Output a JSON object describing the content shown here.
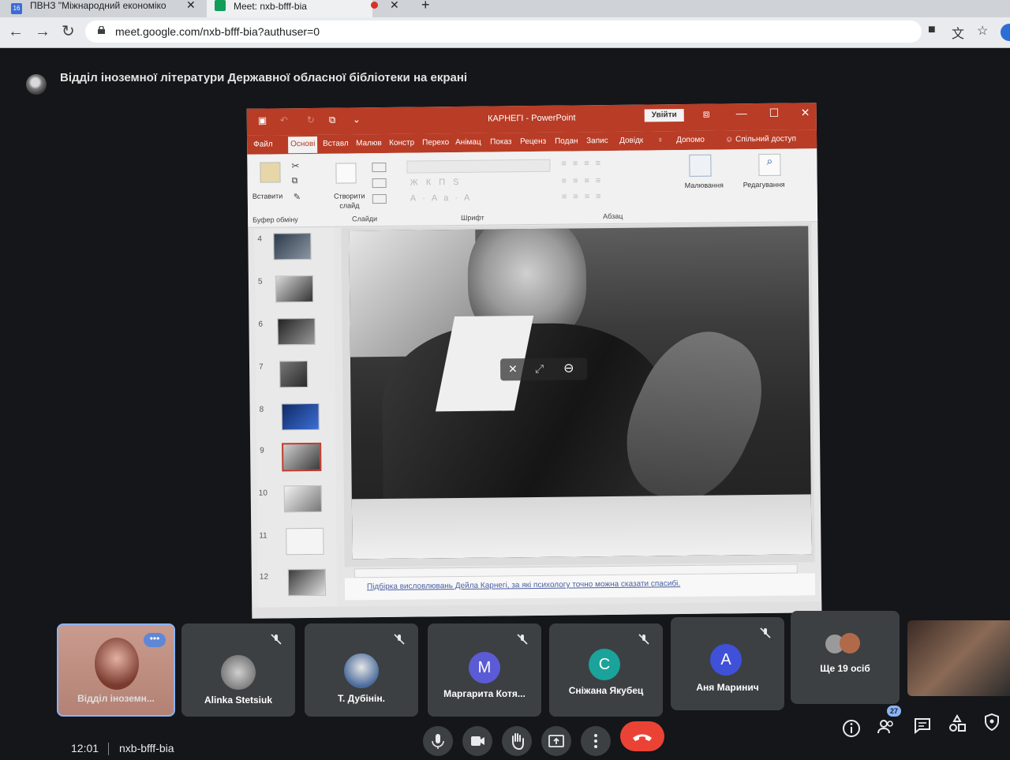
{
  "browser": {
    "tabs": [
      {
        "title": "ПВНЗ \"Міжнародний економіко",
        "favicon_text": "16"
      },
      {
        "title": "Meet: nxb-bfff-bia"
      }
    ],
    "url": "meet.google.com/nxb-bfff-bia?authuser=0"
  },
  "meet": {
    "presenter_text": "Відділ іноземної літератури Державної обласної бібліотеки на екрані",
    "participants": [
      {
        "name": "Відділ іноземн...",
        "kind": "video"
      },
      {
        "name": "Alinka Stetsiuk",
        "kind": "photo",
        "muted": true
      },
      {
        "name": "Т. Дубінін.",
        "kind": "photo",
        "muted": true
      },
      {
        "name": "Маргарита Котя...",
        "kind": "letter",
        "letter": "М",
        "color": "#5b5bd6",
        "muted": true
      },
      {
        "name": "Сніжана Якубец",
        "kind": "letter",
        "letter": "С",
        "color": "#1aa39a",
        "muted": true
      },
      {
        "name": "Аня Маринич",
        "kind": "letter",
        "letter": "А",
        "color": "#3f51d9",
        "muted": true
      },
      {
        "name": "Ще 19 осіб",
        "kind": "more"
      }
    ],
    "clock": "12:01",
    "meeting_code": "nxb-bfff-bia",
    "participant_count": "27",
    "controls": [
      "mic-icon",
      "camera-icon",
      "raise-hand-icon",
      "present-screen-icon",
      "more-options-icon",
      "hang-up-icon"
    ],
    "right_controls": [
      "info-icon",
      "people-icon",
      "chat-icon",
      "activities-icon",
      "host-controls-icon"
    ],
    "colors": {
      "hangup": "#ea4335",
      "tile": "#3c4043",
      "background": "#141619"
    }
  },
  "ppt": {
    "title": "КАРНЕГІ - PowerPoint",
    "signin": "Увійти",
    "tabs": [
      "Файл",
      "Основі",
      "Вставл",
      "Малюв",
      "Констр",
      "Перехо",
      "Анімац",
      "Показ",
      "Реценз",
      "Подан",
      "Запис",
      "Довідк",
      "Допомо",
      "Спільний доступ"
    ],
    "active_tab": "Основі",
    "ribbon": {
      "paste": "Вставити",
      "new_slide": "Створити слайд",
      "drawing": "Малювання",
      "editing": "Редагування",
      "groups": [
        "Буфер обміну",
        "Слайди",
        "Шрифт",
        "Абзац"
      ]
    },
    "slide_numbers": [
      "4",
      "5",
      "6",
      "7",
      "8",
      "9",
      "10",
      "11",
      "12"
    ],
    "selected_slide": "9",
    "notes": "Підбірка висловлювань Дейла Карнегі, за які психологу точно можна сказати спасибі."
  }
}
